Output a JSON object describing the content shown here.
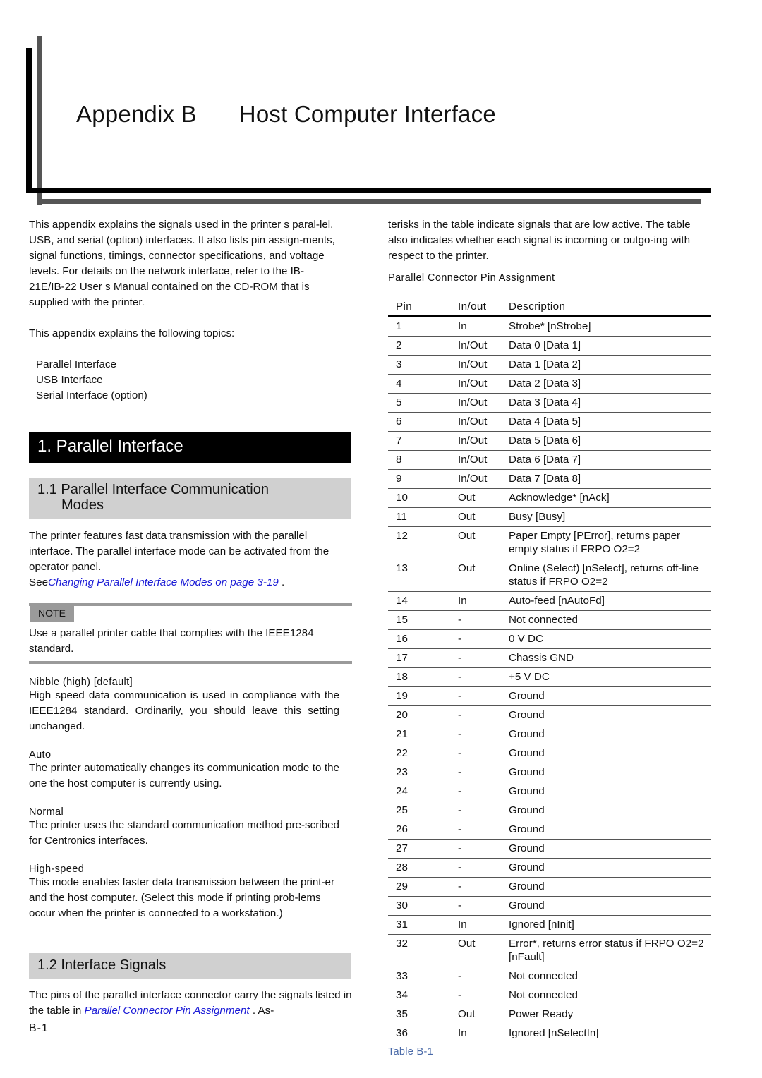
{
  "header": {
    "appendix": "Appendix B",
    "title": "Host Computer Interface"
  },
  "intro": {
    "p1": "This appendix explains the signals used in the printer s paral-lel, USB, and serial (option) interfaces. It also lists pin assign-ments, signal functions, timings, connector specifications, and voltage levels. For details on the network interface, refer to the IB-21E/IB-22 User s Manual contained on the CD-ROM that is supplied with the printer.",
    "p2": "This appendix explains the following topics:",
    "topics": [
      "Parallel Interface",
      "USB Interface",
      "Serial Interface (option)"
    ]
  },
  "section1": {
    "title": "1. Parallel Interface"
  },
  "section11": {
    "title_line1": "1.1 Parallel Interface Communication",
    "title_line2": "Modes",
    "body": "The printer features fast data transmission with the parallel interface. The parallel interface mode can be activated from the operator panel.",
    "see_prefix": "See",
    "see_link": "Changing Parallel Interface Modes on page 3-19",
    "see_suffix": " ."
  },
  "note": {
    "label": "NOTE",
    "text": "Use a parallel printer cable that complies with the IEEE1284 standard."
  },
  "modes": [
    {
      "term": "Nibble (high) [default]",
      "desc": "High speed data communication is used in compliance with the IEEE1284 standard. Ordinarily, you should leave this setting unchanged."
    },
    {
      "term": "Auto",
      "desc": "The printer automatically changes its communication mode to the one the host computer is currently using."
    },
    {
      "term": "Normal",
      "desc": "The printer uses the standard communication method pre-scribed for Centronics interfaces."
    },
    {
      "term": "High-speed",
      "desc": "This mode enables faster data transmission between the print-er and the host computer. (Select this mode if printing prob-lems occur when the printer is connected to a workstation.)"
    }
  ],
  "section12": {
    "title": "1.2 Interface Signals",
    "body_prefix": "The pins of the parallel interface connector carry the signals listed in the table in ",
    "body_link": "Parallel Connector Pin Assignment",
    "body_suffix": " . As-"
  },
  "right": {
    "p1": "terisks in the table indicate signals that are low active. The table also indicates whether each signal is incoming or outgo-ing with respect to the printer.",
    "table_title": "Parallel Connector Pin Assignment"
  },
  "pin_table": {
    "headers": [
      "Pin",
      "In/out",
      "Description"
    ],
    "rows": [
      [
        "1",
        "In",
        "Strobe* [nStrobe]"
      ],
      [
        "2",
        "In/Out",
        "Data 0 [Data 1]"
      ],
      [
        "3",
        "In/Out",
        "Data 1 [Data 2]"
      ],
      [
        "4",
        "In/Out",
        "Data 2 [Data 3]"
      ],
      [
        "5",
        "In/Out",
        "Data 3 [Data 4]"
      ],
      [
        "6",
        "In/Out",
        "Data 4 [Data 5]"
      ],
      [
        "7",
        "In/Out",
        "Data 5 [Data 6]"
      ],
      [
        "8",
        "In/Out",
        "Data 6 [Data 7]"
      ],
      [
        "9",
        "In/Out",
        "Data 7 [Data 8]"
      ],
      [
        "10",
        "Out",
        "Acknowledge* [nAck]"
      ],
      [
        "11",
        "Out",
        "Busy [Busy]"
      ],
      [
        "12",
        "Out",
        "Paper Empty [PError], returns paper empty status if FRPO O2=2"
      ],
      [
        "13",
        "Out",
        "Online (Select) [nSelect], returns off-line status if FRPO O2=2"
      ],
      [
        "14",
        "In",
        "Auto-feed [nAutoFd]"
      ],
      [
        "15",
        "-",
        "Not connected"
      ],
      [
        "16",
        "-",
        "0 V DC"
      ],
      [
        "17",
        "-",
        "Chassis GND"
      ],
      [
        "18",
        "-",
        "+5 V DC"
      ],
      [
        "19",
        "-",
        "Ground"
      ],
      [
        "20",
        "-",
        "Ground"
      ],
      [
        "21",
        "-",
        "Ground"
      ],
      [
        "22",
        "-",
        "Ground"
      ],
      [
        "23",
        "-",
        "Ground"
      ],
      [
        "24",
        "-",
        "Ground"
      ],
      [
        "25",
        "-",
        "Ground"
      ],
      [
        "26",
        "-",
        "Ground"
      ],
      [
        "27",
        "-",
        "Ground"
      ],
      [
        "28",
        "-",
        "Ground"
      ],
      [
        "29",
        "-",
        "Ground"
      ],
      [
        "30",
        "-",
        "Ground"
      ],
      [
        "31",
        "In",
        "Ignored [nInit]"
      ],
      [
        "32",
        "Out",
        "Error*, returns error status if FRPO O2=2 [nFault]"
      ],
      [
        "33",
        "-",
        "Not connected"
      ],
      [
        "34",
        "-",
        "Not connected"
      ],
      [
        "35",
        "Out",
        "Power Ready"
      ],
      [
        "36",
        "In",
        "Ignored [nSelectIn]"
      ]
    ],
    "caption": "Table B-1"
  },
  "footer": {
    "page_number": "B-1"
  },
  "colors": {
    "link": "#1a1ad6",
    "caption": "#4a6aa8",
    "section_band": "#d0d0d0",
    "note_gray": "#9a9a9a"
  }
}
